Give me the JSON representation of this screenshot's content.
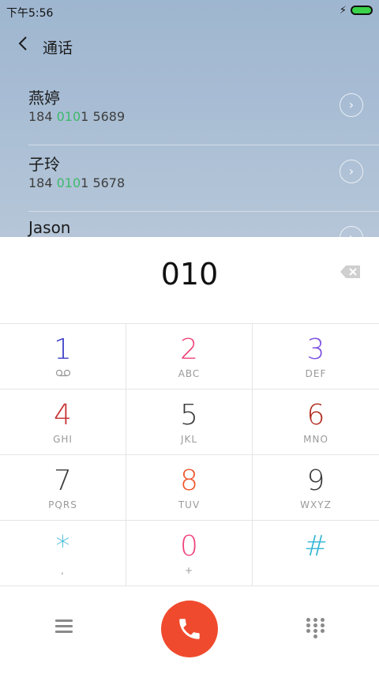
{
  "status": {
    "time": "下午5:56"
  },
  "header": {
    "back_icon": "back-chevron-icon",
    "title": "通话"
  },
  "contacts": [
    {
      "name": "燕婷",
      "num_pre": "184 ",
      "num_hl": "010",
      "num_post": "1 5689"
    },
    {
      "name": "子玲",
      "num_pre": "184 ",
      "num_hl": "010",
      "num_post": "1 5678"
    },
    {
      "name": "Jason",
      "num_pre": "",
      "num_hl": "",
      "num_post": ""
    }
  ],
  "dialer": {
    "number": "010"
  },
  "keys": [
    [
      {
        "digit": "1",
        "sub": "",
        "color": "#3b3ec6"
      },
      {
        "digit": "2",
        "sub": "ABC",
        "color": "#f0457a"
      },
      {
        "digit": "3",
        "sub": "DEF",
        "color": "#7d52e0"
      }
    ],
    [
      {
        "digit": "4",
        "sub": "GHI",
        "color": "#c62f2f"
      },
      {
        "digit": "5",
        "sub": "JKL",
        "color": "#3a3a3a"
      },
      {
        "digit": "6",
        "sub": "MNO",
        "color": "#b02a1e"
      }
    ],
    [
      {
        "digit": "7",
        "sub": "PQRS",
        "color": "#3a3a3a"
      },
      {
        "digit": "8",
        "sub": "TUV",
        "color": "#f0542a"
      },
      {
        "digit": "9",
        "sub": "WXYZ",
        "color": "#3a3a3a"
      }
    ],
    [
      {
        "digit": "*",
        "sub": ",",
        "color": "#33b6d6"
      },
      {
        "digit": "0",
        "sub": "+",
        "color": "#f0427a"
      },
      {
        "digit": "#",
        "sub": "",
        "color": "#33b6d6"
      }
    ]
  ],
  "colors": {
    "call": "#f04a2e",
    "highlight": "#3eb96b"
  }
}
